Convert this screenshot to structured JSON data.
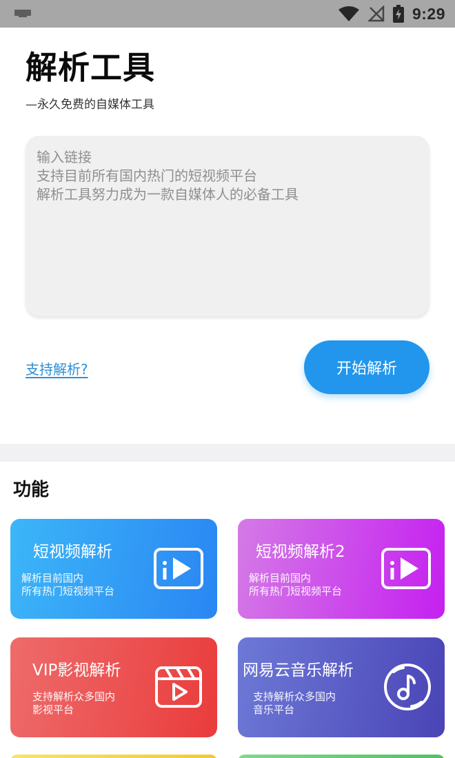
{
  "status_bar": {
    "time": "9:29",
    "icons": [
      "notification-icon",
      "wifi-icon",
      "no-signal-icon",
      "battery-charging-icon"
    ]
  },
  "header": {
    "title": "解析工具",
    "subtitle": "—永久免费的自媒体工具"
  },
  "input": {
    "placeholder_lines": [
      "输入链接",
      "支持目前所有国内热门的短视频平台",
      "解析工具努力成为一款自媒体人的必备工具"
    ]
  },
  "actions": {
    "support_link": "支持解析?",
    "start_button": "开始解析"
  },
  "features": {
    "title": "功能",
    "cards": [
      {
        "title": "短视频解析",
        "desc_lines": [
          "解析目前国内",
          "所有热门短视频平台"
        ],
        "icon": "video-play-icon",
        "colors": [
          "#3cb6f8",
          "#2a86f3"
        ]
      },
      {
        "title": "短视频解析2",
        "desc_lines": [
          "解析目前国内",
          "所有热门短视频平台"
        ],
        "icon": "video-play-icon",
        "colors": [
          "#d47ae6",
          "#c520f0"
        ]
      },
      {
        "title": "VIP影视解析",
        "desc_lines": [
          "支持解析众多国内",
          "影视平台"
        ],
        "icon": "clapperboard-icon",
        "colors": [
          "#ee6b6b",
          "#ea3c3c"
        ]
      },
      {
        "title": "网易云音乐解析",
        "desc_lines": [
          "支持解析众多国内",
          "音乐平台"
        ],
        "icon": "music-disc-icon",
        "colors": [
          "#6d79d6",
          "#4a44b6"
        ]
      }
    ]
  },
  "colors": {
    "accent": "#2196ec",
    "link": "#2e8fd6",
    "status_bar": "#a7a7a7"
  }
}
